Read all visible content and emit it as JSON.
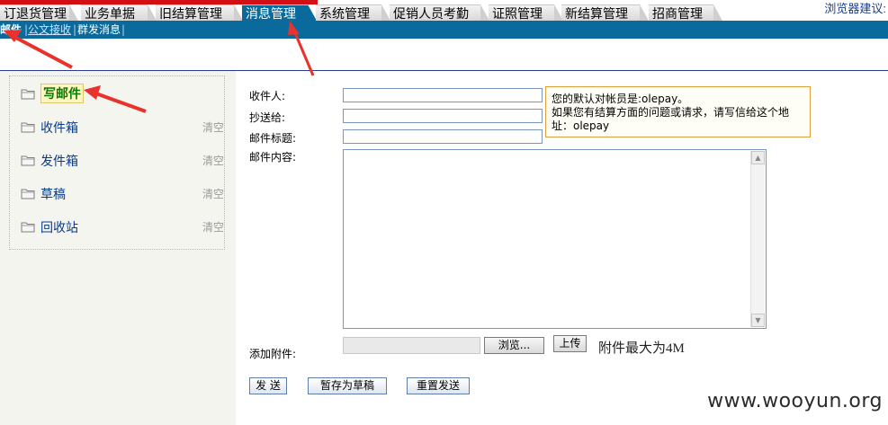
{
  "top_nav": {
    "tabs": [
      {
        "label": "订退货管理",
        "active": false
      },
      {
        "label": "业务单据",
        "active": false
      },
      {
        "label": "旧结算管理",
        "active": false
      },
      {
        "label": "消息管理",
        "active": true
      },
      {
        "label": "系统管理",
        "active": false
      },
      {
        "label": "促销人员考勤",
        "active": false
      },
      {
        "label": "证照管理",
        "active": false
      },
      {
        "label": "新结算管理",
        "active": false
      },
      {
        "label": "招商管理",
        "active": false
      }
    ],
    "top_right_text": "浏览器建议:"
  },
  "sub_nav": {
    "items": [
      {
        "label": "邮件",
        "active": true
      },
      {
        "label": "公文接收",
        "active": false
      },
      {
        "label": "群发消息",
        "active": false
      }
    ]
  },
  "sidebar": {
    "items": [
      {
        "label": "写邮件",
        "clear": ""
      },
      {
        "label": "收件箱",
        "clear": "清空"
      },
      {
        "label": "发件箱",
        "clear": "清空"
      },
      {
        "label": "草稿",
        "clear": "清空"
      },
      {
        "label": "回收站",
        "clear": "清空"
      }
    ]
  },
  "form": {
    "to_label": "收件人:",
    "cc_label": "抄送给:",
    "subject_label": "邮件标题:",
    "body_label": "邮件内容:",
    "attach_label": "添加附件:",
    "browse_label": "浏览...",
    "upload_label": "上传",
    "attach_note": "附件最大为4M",
    "tooltip_line1": "您的默认对帐员是:olepay。",
    "tooltip_line2": "如果您有结算方面的问题或请求，请写信给这个地址：olepay"
  },
  "actions": {
    "send": "发 送",
    "save_draft": "暂存为草稿",
    "resend": "重置发送"
  },
  "watermark": "www.wooyun.org",
  "colors": {
    "header_blue": "#0a6a9c",
    "banner_red": "#d20f14",
    "annotation_red": "#e8322b"
  }
}
